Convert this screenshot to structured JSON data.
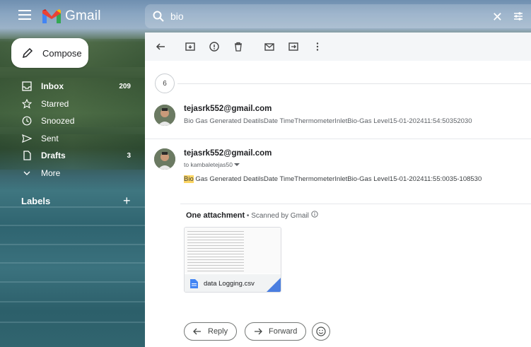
{
  "app": {
    "name": "Gmail"
  },
  "search": {
    "query": "bio"
  },
  "sidebar": {
    "compose_label": "Compose",
    "items": [
      {
        "label": "Inbox",
        "count": "209",
        "bold": true
      },
      {
        "label": "Starred",
        "count": ""
      },
      {
        "label": "Snoozed",
        "count": ""
      },
      {
        "label": "Sent",
        "count": ""
      },
      {
        "label": "Drafts",
        "count": "3",
        "bold": true
      },
      {
        "label": "More",
        "count": ""
      }
    ],
    "labels_heading": "Labels",
    "labels_add": "+"
  },
  "thread": {
    "collapsed_count": "6",
    "messages": [
      {
        "sender": "tejasrk552@gmail.com",
        "snippet": "Bio Gas Generated DeatilsDate TimeThermometerInletBio-Gas Level15-01-202411:54:50352030"
      },
      {
        "sender": "tejasrk552@gmail.com",
        "to": "to kambaletejas50",
        "body_highlight": "Bio",
        "body_rest": " Gas Generated DeatilsDate TimeThermometerInletBio-Gas Level15-01-202411:55:0035-108530"
      }
    ],
    "attachment": {
      "heading": "One attachment",
      "scanned": " • Scanned by Gmail",
      "file_name": "data Logging.csv"
    }
  },
  "actions": {
    "reply": "Reply",
    "forward": "Forward"
  },
  "colors": {
    "accent": "#1a73e8",
    "highlight": "#fdd663",
    "file_blue": "#4a7ee0"
  }
}
